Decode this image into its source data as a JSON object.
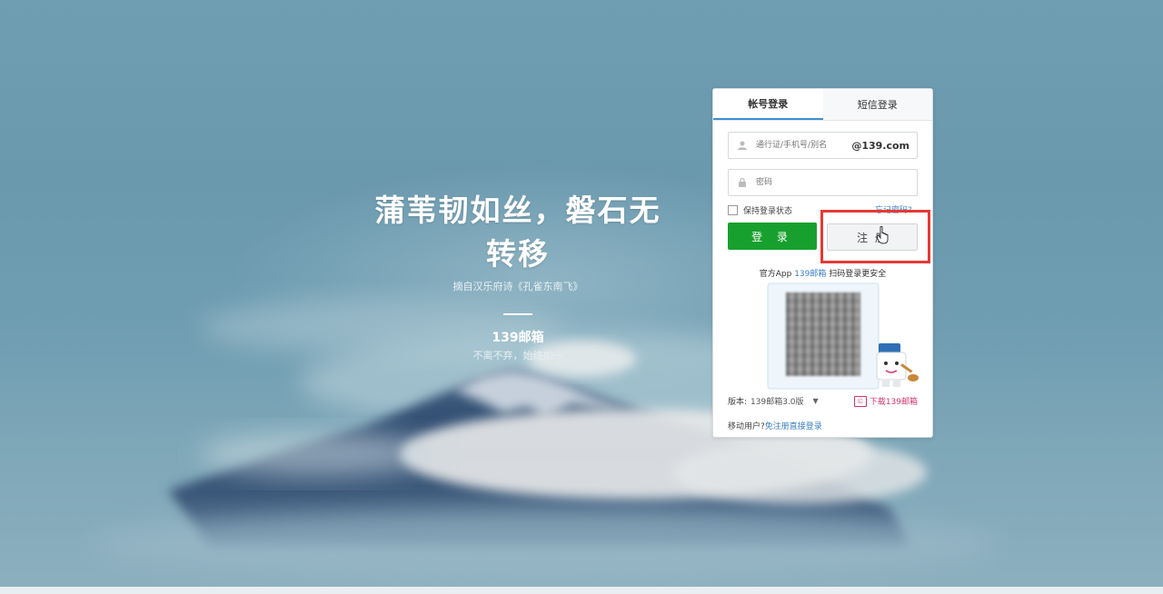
{
  "slogan": {
    "title": "蒲苇韧如丝，磐石无转移",
    "source": "摘自汉乐府诗《孔雀东南飞》",
    "brand": "139邮箱",
    "tagline": "不离不弃，始终如一"
  },
  "login": {
    "tabs": [
      {
        "label": "帐号登录",
        "active": true
      },
      {
        "label": "短信登录",
        "active": false
      }
    ],
    "username_placeholder": "通行证/手机号/别名",
    "domain_suffix": "@139.com",
    "password_placeholder": "密码",
    "remember_label": "保持登录状态",
    "forgot_label": "忘记密码?",
    "login_button": "登 录",
    "register_button": "注 册",
    "app_prefix": "官方App",
    "app_link": "139邮箱",
    "app_suffix": "扫码登录更安全",
    "version_label": "版本:",
    "version_value": "139邮箱3.0版",
    "download_label": "下载139邮箱",
    "mobile_prefix": "移动用户?",
    "mobile_link": "免注册直接登录"
  },
  "colors": {
    "login_green": "#18a02e",
    "highlight_red": "#e53935",
    "link_blue": "#3b7fc4",
    "download_pink": "#d6336c"
  },
  "icons": [
    "user-icon",
    "lock-icon",
    "cursor-hand-icon",
    "mascot-icon",
    "download-icon",
    "caret-down-icon"
  ]
}
